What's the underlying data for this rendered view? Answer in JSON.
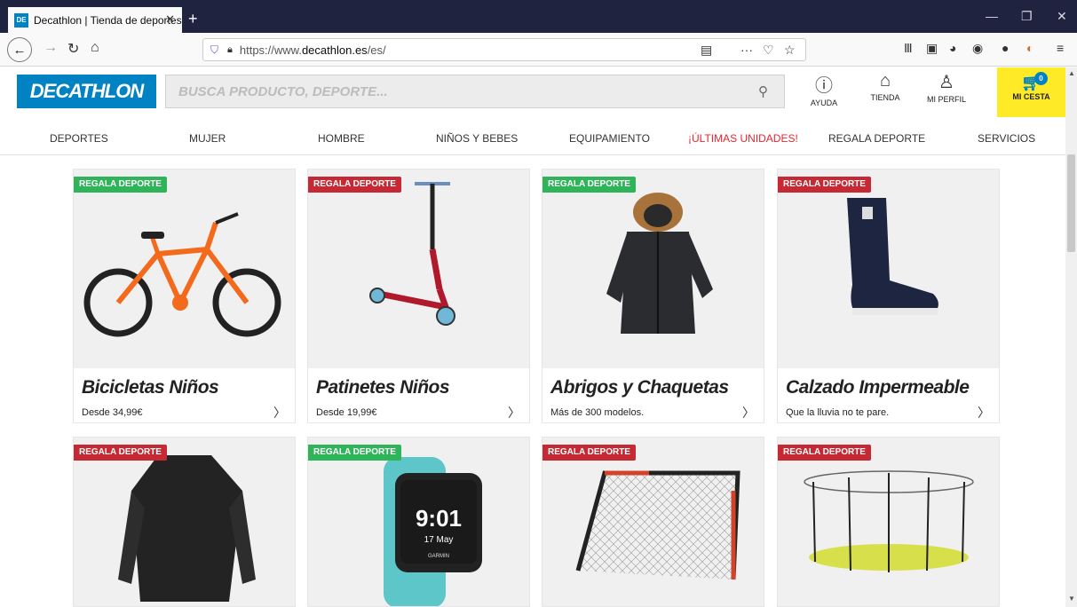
{
  "browser": {
    "tab_title": "Decathlon | Tienda de deportes",
    "favicon_text": "DE",
    "url_prefix": "https://www.",
    "url_domain": "decathlon.es",
    "url_path": "/es/"
  },
  "header": {
    "logo": "DECATHLON",
    "search_placeholder": "BUSCA PRODUCTO, DEPORTE...",
    "ayuda": "AYUDA",
    "tienda": "TIENDA",
    "perfil": "MI PERFIL",
    "cesta": "MI CESTA",
    "cesta_count": "0"
  },
  "menu": [
    "DEPORTES",
    "MUJER",
    "HOMBRE",
    "NIÑOS Y BEBES",
    "EQUIPAMIENTO",
    "¡ÚLTIMAS UNIDADES!",
    "REGALA DEPORTE",
    "SERVICIOS"
  ],
  "cards": [
    {
      "badge": "REGALA DEPORTE",
      "badge_color": "green",
      "title": "Bicicletas Niños",
      "sub": "Desde 34,99€"
    },
    {
      "badge": "REGALA DEPORTE",
      "badge_color": "red",
      "title": "Patinetes Niños",
      "sub": "Desde 19,99€"
    },
    {
      "badge": "REGALA DEPORTE",
      "badge_color": "green",
      "title": "Abrigos y Chaquetas",
      "sub": "Más de 300 modelos."
    },
    {
      "badge": "REGALA DEPORTE",
      "badge_color": "red",
      "title": "Calzado Impermeable",
      "sub": "Que la lluvia no te pare."
    },
    {
      "badge": "REGALA DEPORTE",
      "badge_color": "red"
    },
    {
      "badge": "REGALA DEPORTE",
      "badge_color": "green",
      "watch_time": "9:01",
      "watch_date": "17 May",
      "watch_brand": "GARMIN"
    },
    {
      "badge": "REGALA DEPORTE",
      "badge_color": "red"
    },
    {
      "badge": "REGALA DEPORTE",
      "badge_color": "red"
    }
  ]
}
